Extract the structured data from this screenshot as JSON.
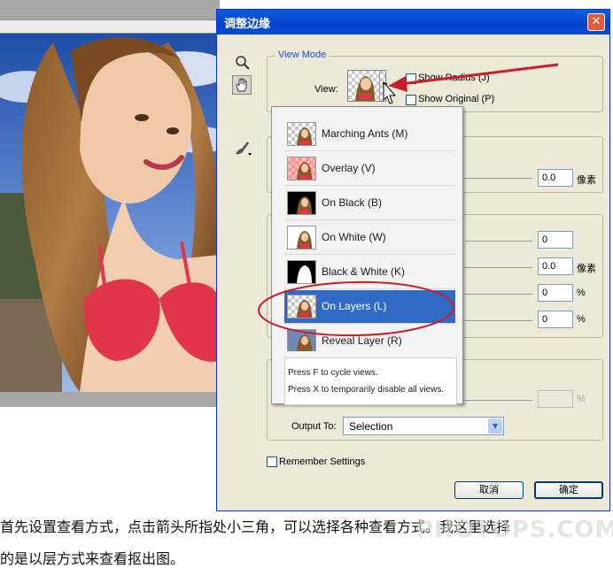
{
  "dialog": {
    "title": "调整边缘",
    "close_label": "✕",
    "view_mode": {
      "legend": "View Mode",
      "view_label": "View:",
      "show_radius": "Show Radius (J)",
      "show_original": "Show Original (P)"
    },
    "radius_value": "0.0",
    "radius_unit": "像素",
    "adjust_values": [
      "0",
      "0.0",
      "0",
      "0"
    ],
    "adjust_units": [
      "",
      "像素",
      "%",
      "%"
    ],
    "amount_unit": "%",
    "output_to_label": "Output To:",
    "output_to_value": "Selection",
    "remember_settings": "Remember Settings",
    "cancel_label": "取消",
    "ok_label": "确定"
  },
  "view_dropdown": {
    "items": [
      {
        "label": "Marching Ants (M)",
        "icon": "marching-ants-icon"
      },
      {
        "label": "Overlay (V)",
        "icon": "overlay-icon"
      },
      {
        "label": "On Black (B)",
        "icon": "on-black-icon"
      },
      {
        "label": "On White (W)",
        "icon": "on-white-icon"
      },
      {
        "label": "Black & White (K)",
        "icon": "black-white-icon"
      },
      {
        "label": "On Layers (L)",
        "icon": "on-layers-icon",
        "selected": true
      },
      {
        "label": "Reveal Layer (R)",
        "icon": "reveal-layer-icon"
      }
    ],
    "hint_line1": "Press F to cycle views.",
    "hint_line2": "Press X to temporarily disable all views."
  },
  "caption": {
    "line1": "首先设置查看方式，点击箭头所指处小三角，可以选择各种查看方式。我这里选择",
    "line2": "的是以层方式来查看抠出图。"
  },
  "watermark": "PHOTOPS.COM",
  "colors": {
    "selection": "#316ac5",
    "titlebar": "#0542c9",
    "annotation_red": "#c8202a"
  }
}
